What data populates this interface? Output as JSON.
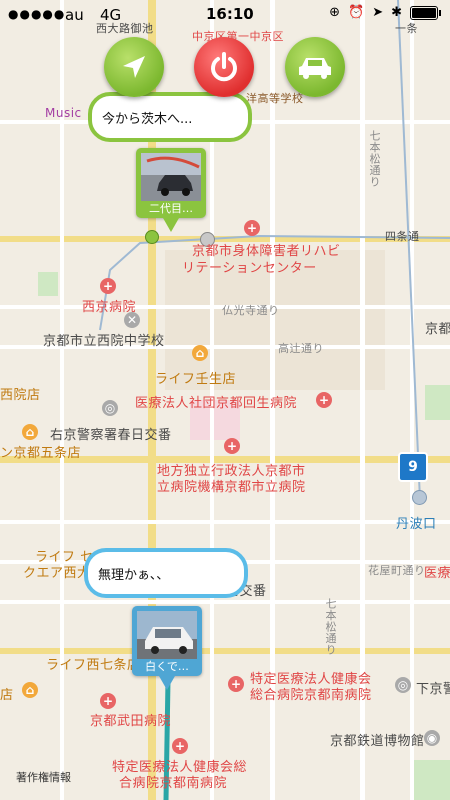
{
  "status": {
    "carrier": "au",
    "network": "4G",
    "time": "16:10"
  },
  "buttons": {
    "navigate": "navigate-arrow",
    "power": "power-icon",
    "car": "car-icon"
  },
  "bubbles": {
    "top": "今から茨木へ...",
    "bottom": "無理かぁ、、"
  },
  "markers": {
    "top_caption": "二代目…",
    "bottom_caption": "白くで…"
  },
  "map_labels": {
    "pond": "西大路御池",
    "school_partial": "中京区第一中京区",
    "high_school": "洋高等学校",
    "music": "Music",
    "jo": "一条",
    "shijo": "四条通",
    "rehab1": "京都市身体障害者リハビ",
    "rehab2": "リテーションセンター",
    "nishikyo_hosp": "西京病院",
    "bukkoji": "仏光寺通り",
    "junior_high": "京都市立西院中学校",
    "takatsuji": "高辻通り",
    "life_mibu": "ライフ壬生店",
    "saiin": "西院店",
    "kyoto_kaisei": "医療法人社団京都回生病院",
    "ukyo_police": "右京警察署春日交番",
    "gojo": "ン京都五条店",
    "city_hosp1": "地方独立行政法人京都市",
    "city_hosp2": "立病院機構京都市立病院",
    "route9": "9",
    "tanbaguchi": "丹波口",
    "life_se": "ライフ セ",
    "quare": "クエア西大",
    "hanayamachi": "花屋町通り",
    "kobanyori": "河交番",
    "iryo_right": "医療",
    "life_nishi7": "ライフ西七条店",
    "kenko1": "特定医療法人健康会",
    "kenko2": "総合病院京都南病院",
    "shimokyo": "下京警",
    "takeda": "京都武田病院",
    "ten": "店",
    "railway_museum": "京都鉄道博物館",
    "kenko3": "特定医療法人健康会総",
    "kenko4": "合病院京都南病院",
    "shichihon1": "七本松通り",
    "shichihon2": "七本松通り",
    "kyoto_right": "京都",
    "copyright": "著作権情報"
  },
  "colors": {
    "green": "#8bc43f",
    "blue": "#4fa6d4",
    "red": "#e02f2f"
  }
}
